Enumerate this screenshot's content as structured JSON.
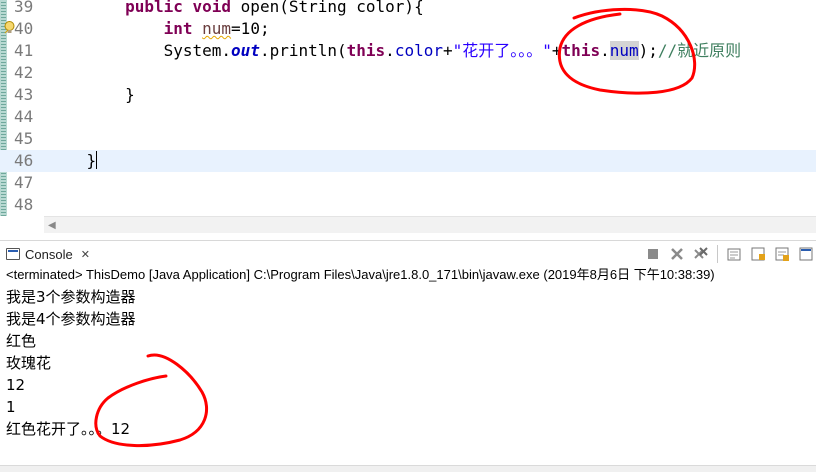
{
  "editor": {
    "lines": [
      {
        "number": "39"
      },
      {
        "number": "40"
      },
      {
        "number": "41"
      },
      {
        "number": "42"
      },
      {
        "number": "43"
      },
      {
        "number": "44"
      },
      {
        "number": "45"
      },
      {
        "number": "46"
      },
      {
        "number": "47"
      },
      {
        "number": "48"
      }
    ],
    "code": {
      "l39_kw1": "public",
      "l39_kw2": "void",
      "l39_rest": "open(String color){",
      "l40_kw": "int",
      "l40_var": "num",
      "l40_rest": "=10;",
      "l41_a": "System.",
      "l41_out": "out",
      "l41_b": ".println(",
      "l41_this1": "this",
      "l41_dot1": ".",
      "l41_color": "color",
      "l41_plus1": "+",
      "l41_str": "\"花开了。。。\"",
      "l41_plus2": "+",
      "l41_this2": "this",
      "l41_dot2": ".",
      "l41_num": "num",
      "l41_end": ");",
      "l41_comment": "//就近原则",
      "l43_brace": "}",
      "l46_brace": "}"
    }
  },
  "console": {
    "tab_label": "Console",
    "tab_close": "✕",
    "status_line": "<terminated> ThisDemo [Java Application] C:\\Program Files\\Java\\jre1.8.0_171\\bin\\javaw.exe (2019年8月6日 下午10:38:39)",
    "output": [
      "我是3个参数构造器",
      "我是4个参数构造器",
      "红色",
      "玫瑰花",
      "12",
      "1",
      "红色花开了。。。12"
    ],
    "toolbar_icons": [
      "terminate-icon",
      "remove-launch-icon",
      "remove-all-terminated-icon",
      "clear-console-icon",
      "scroll-lock-icon",
      "word-wrap-icon",
      "show-console-icon"
    ]
  },
  "colors": {
    "keyword": "#7f0055",
    "field": "#0000c0",
    "string": "#2a00ff",
    "comment": "#3f7f5f",
    "annotation": "#ff0000"
  }
}
